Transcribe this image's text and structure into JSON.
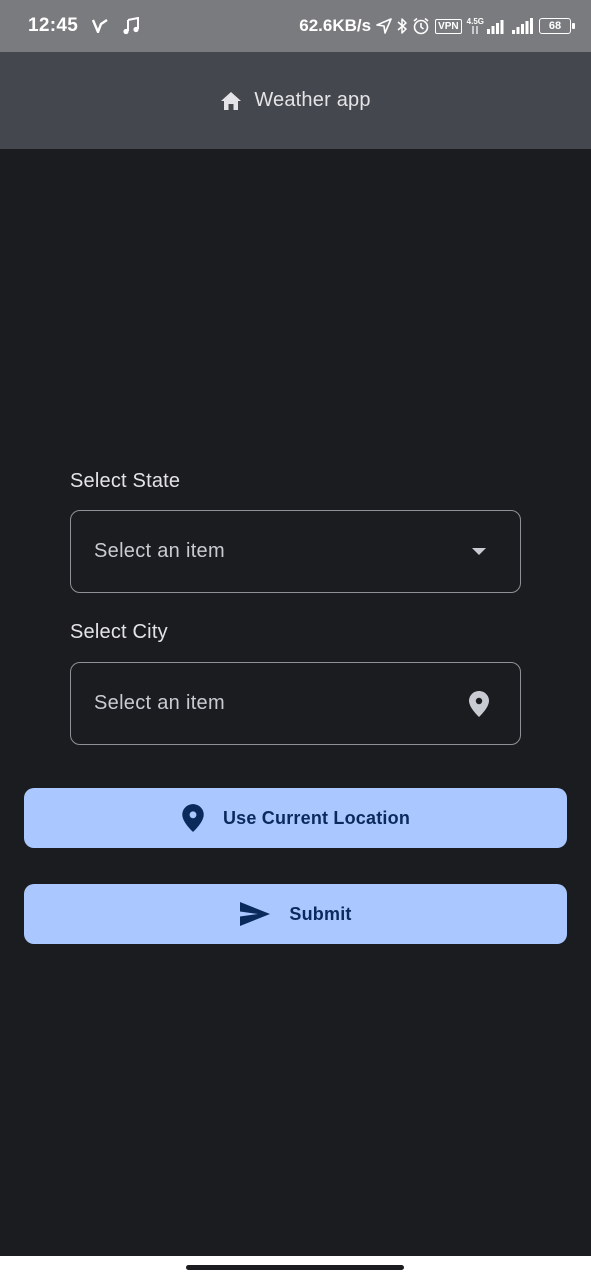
{
  "status_bar": {
    "time": "12:45",
    "net_speed": "62.6KB/s",
    "vpn": "VPN",
    "network_type": "4.5G",
    "battery": "68",
    "icons": [
      "vpn-key-icon",
      "music-note-icon",
      "location-arrow-icon",
      "bluetooth-icon",
      "alarm-icon",
      "signal-icon",
      "signal-icon"
    ]
  },
  "app_bar": {
    "icon": "home-icon",
    "title": "Weather app"
  },
  "form": {
    "state": {
      "label": "Select State",
      "value": "Select an item",
      "icon": "dropdown-arrow-icon"
    },
    "city": {
      "label": "Select City",
      "value": "Select an item",
      "icon": "location-pin-icon"
    }
  },
  "buttons": {
    "location": {
      "label": "Use Current Location",
      "icon": "location-pin-icon"
    },
    "submit": {
      "label": "Submit",
      "icon": "send-icon"
    }
  },
  "colors": {
    "background": "#1b1c1f",
    "app_bar": "#44474d",
    "status_bar": "#7a7b7e",
    "button_bg": "#abc7ff",
    "button_text": "#0b2a5c",
    "field_border": "#8f9199"
  }
}
